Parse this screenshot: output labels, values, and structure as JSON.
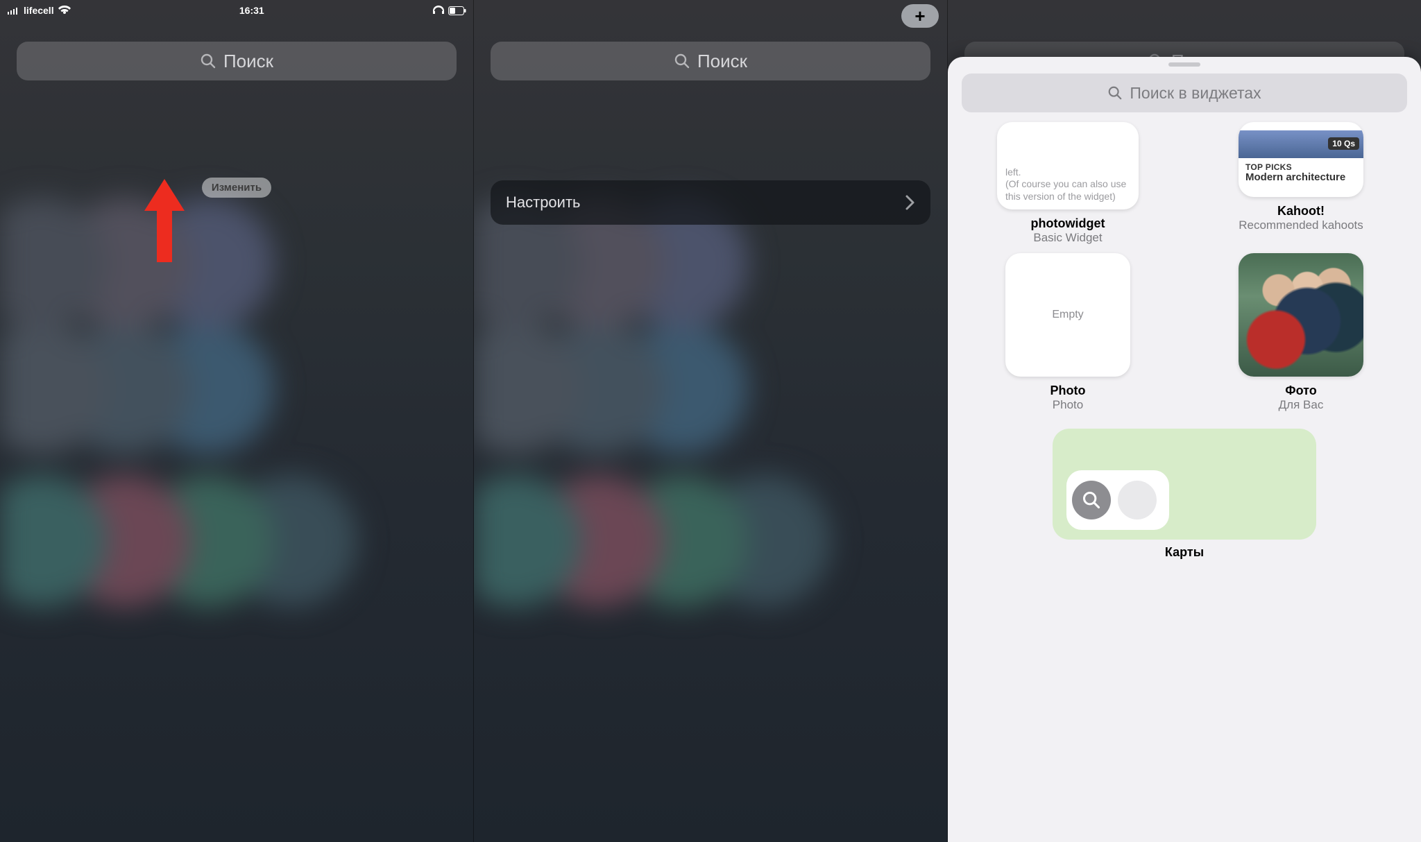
{
  "status_bar": {
    "carrier": "lifecell",
    "time": "16:31"
  },
  "common": {
    "search_placeholder": "Поиск"
  },
  "panel1": {
    "edit_label": "Изменить"
  },
  "panel2": {
    "add_icon_text": "+",
    "configure_label": "Настроить"
  },
  "panel3": {
    "sheet_search_placeholder": "Поиск в виджетах",
    "widgets_row1": [
      {
        "tile_text": "left.\n(Of course you can also use this version of the widget)",
        "title": "photowidget",
        "subtitle": "Basic Widget"
      },
      {
        "badge": "10 Qs",
        "top_picks": "TOP PICKS",
        "headline": "Modern architecture",
        "title": "Kahoot!",
        "subtitle": "Recommended kahoots"
      }
    ],
    "widgets_row2": [
      {
        "tile_text": "Empty",
        "title": "Photo",
        "subtitle": "Photo"
      },
      {
        "title": "Фото",
        "subtitle": "Для Вас"
      }
    ],
    "maps": {
      "title": "Карты"
    }
  }
}
